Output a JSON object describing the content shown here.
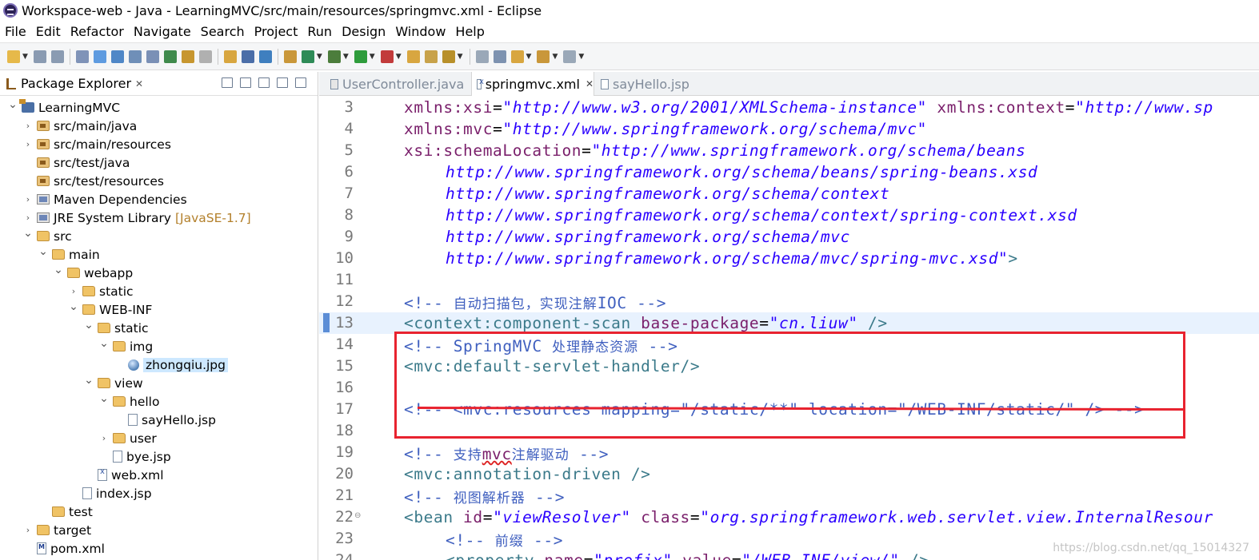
{
  "window": {
    "title": "Workspace-web - Java - LearningMVC/src/main/resources/springmvc.xml - Eclipse"
  },
  "menu": [
    "File",
    "Edit",
    "Refactor",
    "Navigate",
    "Search",
    "Project",
    "Run",
    "Design",
    "Window",
    "Help"
  ],
  "toolbar": {
    "icons": [
      "new-icon",
      "save-icon",
      "save-all-icon",
      "binary-icon",
      "link-icon",
      "outline-icon",
      "javadoc-icon",
      "declaration-icon",
      "type-hierarchy-icon",
      "search-icon",
      "print-icon",
      "open-resource-icon",
      "console-icon",
      "breakpoint-icon",
      "package-icon",
      "refresh-icon",
      "debug-icon",
      "run-icon",
      "external-tools-icon",
      "open-folder-icon",
      "open-task-icon",
      "pin-icon",
      "annotation-icon",
      "next-annotation-icon",
      "last-edit-icon",
      "back-icon",
      "forward-icon"
    ]
  },
  "explorer": {
    "title": "Package Explorer",
    "tree": [
      {
        "label": "LearningMVC",
        "icon": "project-icon",
        "depth": 0,
        "expanded": true
      },
      {
        "label": "src/main/java",
        "icon": "source-folder-icon",
        "depth": 1,
        "expanded": false
      },
      {
        "label": "src/main/resources",
        "icon": "source-folder-icon",
        "depth": 1,
        "expanded": false
      },
      {
        "label": "src/test/java",
        "icon": "source-folder-icon",
        "depth": 1,
        "expanded": null
      },
      {
        "label": "src/test/resources",
        "icon": "source-folder-icon",
        "depth": 1,
        "expanded": null
      },
      {
        "label": "Maven Dependencies",
        "icon": "library-icon",
        "depth": 1,
        "expanded": false
      },
      {
        "label": "JRE System Library",
        "decoration": "[JavaSE-1.7]",
        "icon": "library-icon",
        "depth": 1,
        "expanded": false
      },
      {
        "label": "src",
        "icon": "folder-icon",
        "depth": 1,
        "expanded": true
      },
      {
        "label": "main",
        "icon": "folder-icon",
        "depth": 2,
        "expanded": true
      },
      {
        "label": "webapp",
        "icon": "folder-icon",
        "depth": 3,
        "expanded": true
      },
      {
        "label": "static",
        "icon": "folder-icon",
        "depth": 4,
        "expanded": false
      },
      {
        "label": "WEB-INF",
        "icon": "folder-icon",
        "depth": 4,
        "expanded": true
      },
      {
        "label": "static",
        "icon": "folder-icon",
        "depth": 5,
        "expanded": true
      },
      {
        "label": "img",
        "icon": "folder-icon",
        "depth": 6,
        "expanded": true
      },
      {
        "label": "zhongqiu.jpg",
        "icon": "image-file-icon",
        "depth": 7,
        "expanded": null,
        "selected": true
      },
      {
        "label": "view",
        "icon": "folder-icon",
        "depth": 5,
        "expanded": true
      },
      {
        "label": "hello",
        "icon": "folder-icon",
        "depth": 6,
        "expanded": true
      },
      {
        "label": "sayHello.jsp",
        "icon": "jsp-file-icon",
        "depth": 7,
        "expanded": null
      },
      {
        "label": "user",
        "icon": "folder-icon",
        "depth": 6,
        "expanded": false
      },
      {
        "label": "bye.jsp",
        "icon": "jsp-file-icon",
        "depth": 6,
        "expanded": null
      },
      {
        "label": "web.xml",
        "icon": "xml-file-icon",
        "depth": 5,
        "expanded": null
      },
      {
        "label": "index.jsp",
        "icon": "jsp-file-icon",
        "depth": 4,
        "expanded": null
      },
      {
        "label": "test",
        "icon": "folder-icon",
        "depth": 2,
        "expanded": null
      },
      {
        "label": "target",
        "icon": "folder-icon",
        "depth": 1,
        "expanded": false
      },
      {
        "label": "pom.xml",
        "icon": "maven-file-icon",
        "depth": 1,
        "expanded": null
      }
    ]
  },
  "editor": {
    "tabs": [
      {
        "label": "UserController.java",
        "active": false
      },
      {
        "label": "springmvc.xml",
        "active": true
      },
      {
        "label": "sayHello.jsp",
        "active": false
      }
    ],
    "lines": [
      {
        "no": "3",
        "parts": [
          [
            "attr",
            "xmlns:xsi"
          ],
          [
            "eq",
            "="
          ],
          [
            "val",
            "\"http://www.w3.org/2001/XMLSchema-instance\""
          ],
          [
            "eq",
            " "
          ],
          [
            "attr",
            "xmlns:context"
          ],
          [
            "eq",
            "="
          ],
          [
            "val",
            "\"http://www.sp"
          ]
        ]
      },
      {
        "no": "4",
        "parts": [
          [
            "attr",
            "xmlns:mvc"
          ],
          [
            "eq",
            "="
          ],
          [
            "val",
            "\"http://www.springframework.org/schema/mvc\""
          ]
        ]
      },
      {
        "no": "5",
        "parts": [
          [
            "attr",
            "xsi:schemaLocation"
          ],
          [
            "eq",
            "="
          ],
          [
            "val",
            "\"http://www.springframework.org/schema/beans"
          ]
        ]
      },
      {
        "no": "6",
        "indent": true,
        "parts": [
          [
            "val",
            "http://www.springframework.org/schema/beans/spring-beans.xsd"
          ]
        ]
      },
      {
        "no": "7",
        "indent": true,
        "parts": [
          [
            "val",
            "http://www.springframework.org/schema/context"
          ]
        ]
      },
      {
        "no": "8",
        "indent": true,
        "parts": [
          [
            "val",
            "http://www.springframework.org/schema/context/spring-context.xsd"
          ]
        ]
      },
      {
        "no": "9",
        "indent": true,
        "parts": [
          [
            "val",
            "http://www.springframework.org/schema/mvc"
          ]
        ]
      },
      {
        "no": "10",
        "indent": true,
        "parts": [
          [
            "val",
            "http://www.springframework.org/schema/mvc/spring-mvc.xsd\""
          ],
          [
            "tag",
            ">"
          ]
        ]
      },
      {
        "no": "11",
        "parts": []
      },
      {
        "no": "12",
        "parts": [
          [
            "cmt",
            "<!-- "
          ],
          [
            "cmt-cjk",
            "自动扫描包，实现注解"
          ],
          [
            "cmt",
            "IOC -->"
          ]
        ]
      },
      {
        "no": "13",
        "current": true,
        "parts": [
          [
            "tag",
            "<context:component-scan "
          ],
          [
            "attr",
            "base-package"
          ],
          [
            "eq",
            "="
          ],
          [
            "val",
            "\"cn.liuw\""
          ],
          [
            "tag",
            " />"
          ]
        ]
      },
      {
        "no": "14",
        "parts": [
          [
            "cmt",
            "<!-- SpringMVC "
          ],
          [
            "cmt-cjk",
            "处理静态资源"
          ],
          [
            "cmt",
            " -->"
          ]
        ]
      },
      {
        "no": "15",
        "parts": [
          [
            "tag",
            "<mvc:default-servlet-handler/>"
          ]
        ]
      },
      {
        "no": "16",
        "parts": []
      },
      {
        "no": "17",
        "parts": [
          [
            "cmt",
            "<!-- <mvc:resources mapping=\"/static/**\" location=\"/WEB-INF/static/\" /> -->"
          ]
        ]
      },
      {
        "no": "18",
        "parts": []
      },
      {
        "no": "19",
        "parts": [
          [
            "cmt",
            "<!-- "
          ],
          [
            "cmt-cjk",
            "支持"
          ],
          [
            "kw-ul",
            "mvc"
          ],
          [
            "cmt-cjk",
            "注解驱动"
          ],
          [
            "cmt",
            " -->"
          ]
        ]
      },
      {
        "no": "20",
        "parts": [
          [
            "tag",
            "<mvc:annotation-driven />"
          ]
        ]
      },
      {
        "no": "21",
        "parts": [
          [
            "cmt",
            "<!-- "
          ],
          [
            "cmt-cjk",
            "视图解析器"
          ],
          [
            "cmt",
            " -->"
          ]
        ]
      },
      {
        "no": "22",
        "fold": true,
        "parts": [
          [
            "tag",
            "<bean "
          ],
          [
            "attr",
            "id"
          ],
          [
            "eq",
            "="
          ],
          [
            "val",
            "\"viewResolver\""
          ],
          [
            "eq",
            " "
          ],
          [
            "attr",
            "class"
          ],
          [
            "eq",
            "="
          ],
          [
            "val",
            "\"org.springframework.web.servlet.view.InternalResour"
          ]
        ]
      },
      {
        "no": "23",
        "indent": true,
        "parts": [
          [
            "cmt",
            "<!-- "
          ],
          [
            "cmt-cjk",
            "前缀"
          ],
          [
            "cmt",
            " -->"
          ]
        ]
      },
      {
        "no": "24",
        "indent": true,
        "parts": [
          [
            "tag",
            "<property "
          ],
          [
            "attr",
            "name"
          ],
          [
            "eq",
            "="
          ],
          [
            "val",
            "\"prefix\""
          ],
          [
            "eq",
            " "
          ],
          [
            "attr",
            "value"
          ],
          [
            "eq",
            "="
          ],
          [
            "val",
            "\"/WEB-INF/view/\""
          ],
          [
            "tag",
            " />"
          ]
        ]
      }
    ]
  },
  "watermark": "https://blog.csdn.net/qq_15014327",
  "colors": {
    "highlight_box": "#e8232f",
    "current_line": "#e8f2fe",
    "selection": "#cde8ff"
  }
}
